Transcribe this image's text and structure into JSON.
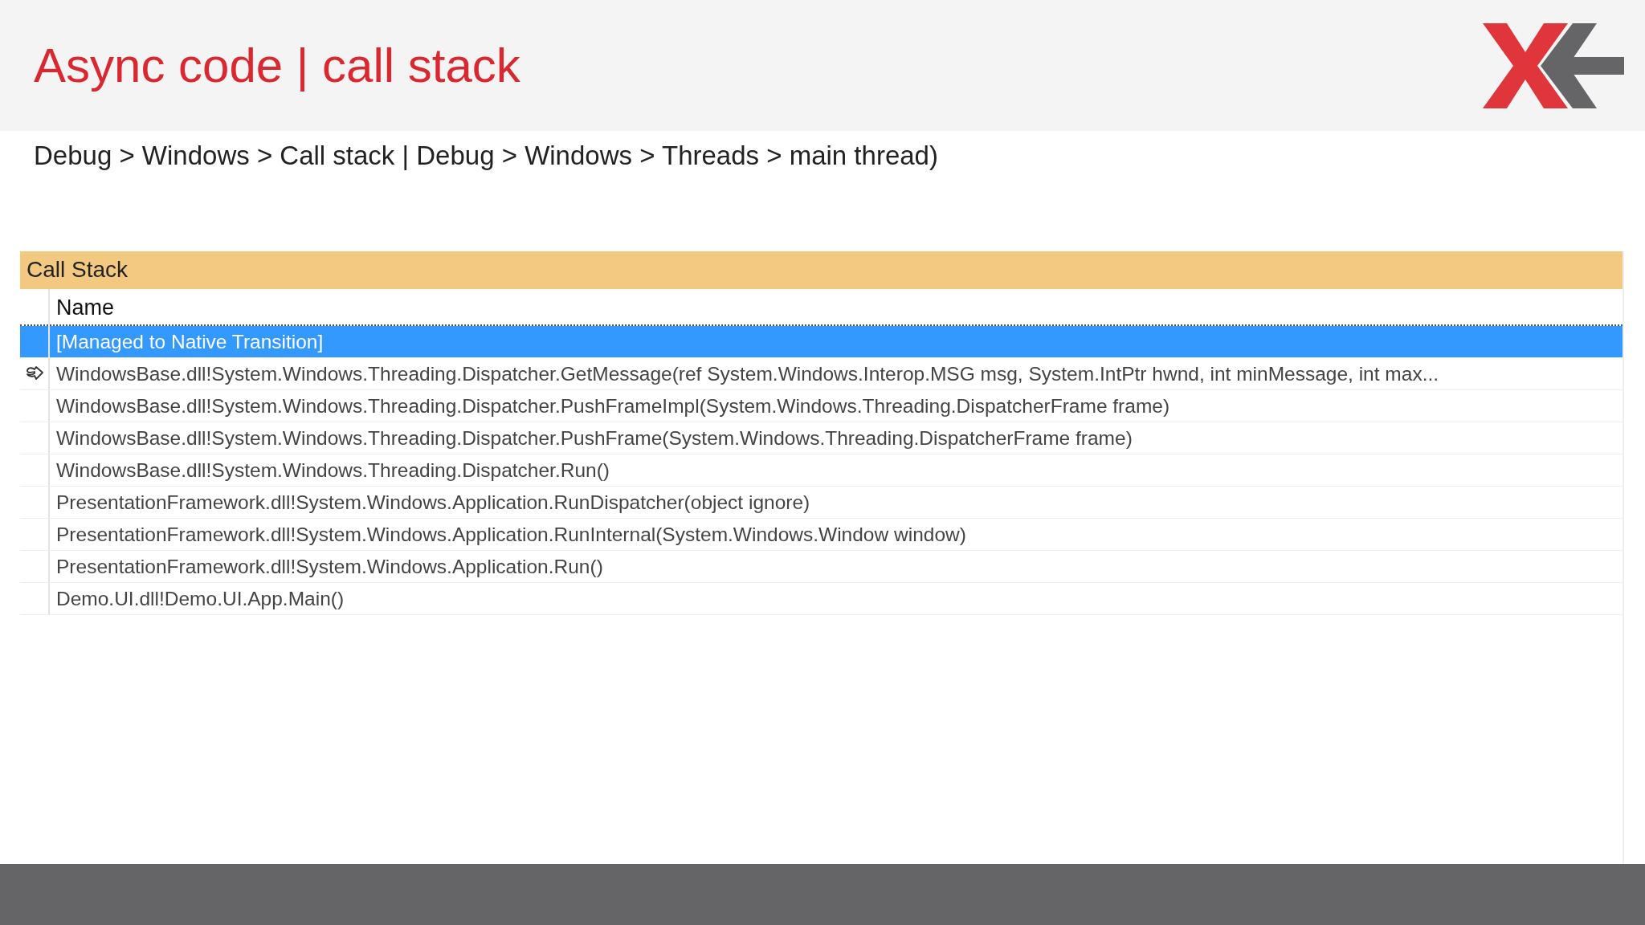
{
  "slide": {
    "title": "Async code | call stack",
    "subtitle": "Debug > Windows > Call stack | Debug > Windows > Threads > main thread)"
  },
  "call_stack": {
    "title": "Call Stack",
    "columns": [
      "Name"
    ],
    "rows": [
      {
        "name": "[Managed to Native Transition]",
        "selected": true,
        "return_arrow": false
      },
      {
        "name": "WindowsBase.dll!System.Windows.Threading.Dispatcher.GetMessage(ref System.Windows.Interop.MSG msg, System.IntPtr hwnd, int minMessage, int max...",
        "selected": false,
        "return_arrow": true
      },
      {
        "name": "WindowsBase.dll!System.Windows.Threading.Dispatcher.PushFrameImpl(System.Windows.Threading.DispatcherFrame frame)",
        "selected": false,
        "return_arrow": false
      },
      {
        "name": "WindowsBase.dll!System.Windows.Threading.Dispatcher.PushFrame(System.Windows.Threading.DispatcherFrame frame)",
        "selected": false,
        "return_arrow": false
      },
      {
        "name": "WindowsBase.dll!System.Windows.Threading.Dispatcher.Run()",
        "selected": false,
        "return_arrow": false
      },
      {
        "name": "PresentationFramework.dll!System.Windows.Application.RunDispatcher(object ignore)",
        "selected": false,
        "return_arrow": false
      },
      {
        "name": "PresentationFramework.dll!System.Windows.Application.RunInternal(System.Windows.Window window)",
        "selected": false,
        "return_arrow": false
      },
      {
        "name": "PresentationFramework.dll!System.Windows.Application.Run()",
        "selected": false,
        "return_arrow": false
      },
      {
        "name": "Demo.UI.dll!Demo.UI.App.Main()",
        "selected": false,
        "return_arrow": false
      }
    ]
  }
}
